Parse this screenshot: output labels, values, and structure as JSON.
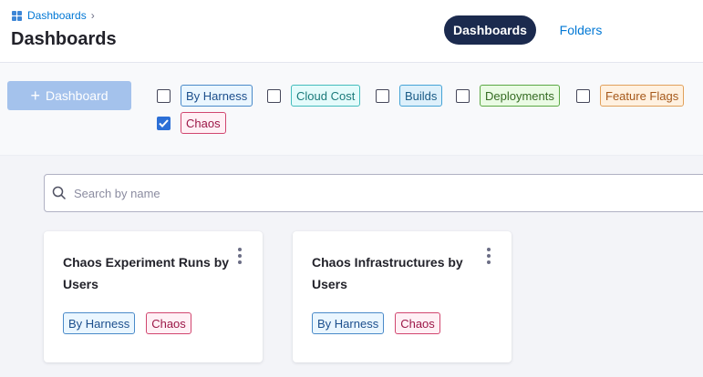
{
  "header": {
    "breadcrumb": {
      "label": "Dashboards",
      "separator": "›",
      "icon": "dashboard-grid-icon"
    },
    "title": "Dashboards",
    "toggle": {
      "active": "Dashboards",
      "inactive": "Folders"
    }
  },
  "filters": {
    "add_button_label": "Dashboard",
    "add_button_icon": "plus-icon",
    "items": [
      {
        "label": "By Harness",
        "checked": false
      },
      {
        "label": "Cloud Cost",
        "checked": false
      },
      {
        "label": "Builds",
        "checked": false
      },
      {
        "label": "Deployments",
        "checked": false
      },
      {
        "label": "Feature Flags",
        "checked": false
      },
      {
        "label": "Chaos",
        "checked": true
      }
    ]
  },
  "search": {
    "placeholder": "Search by name",
    "value": ""
  },
  "cards": [
    {
      "title": "Chaos Experiment Runs by Users",
      "tags": [
        "By Harness",
        "Chaos"
      ]
    },
    {
      "title": "Chaos Infrastructures by Users",
      "tags": [
        "By Harness",
        "Chaos"
      ]
    }
  ],
  "colors": {
    "accent": "#0278d5",
    "toggle_active_bg": "#1b2a4e",
    "add_button_bg": "#a4c2ec",
    "checkbox_checked": "#2c6fd6"
  }
}
